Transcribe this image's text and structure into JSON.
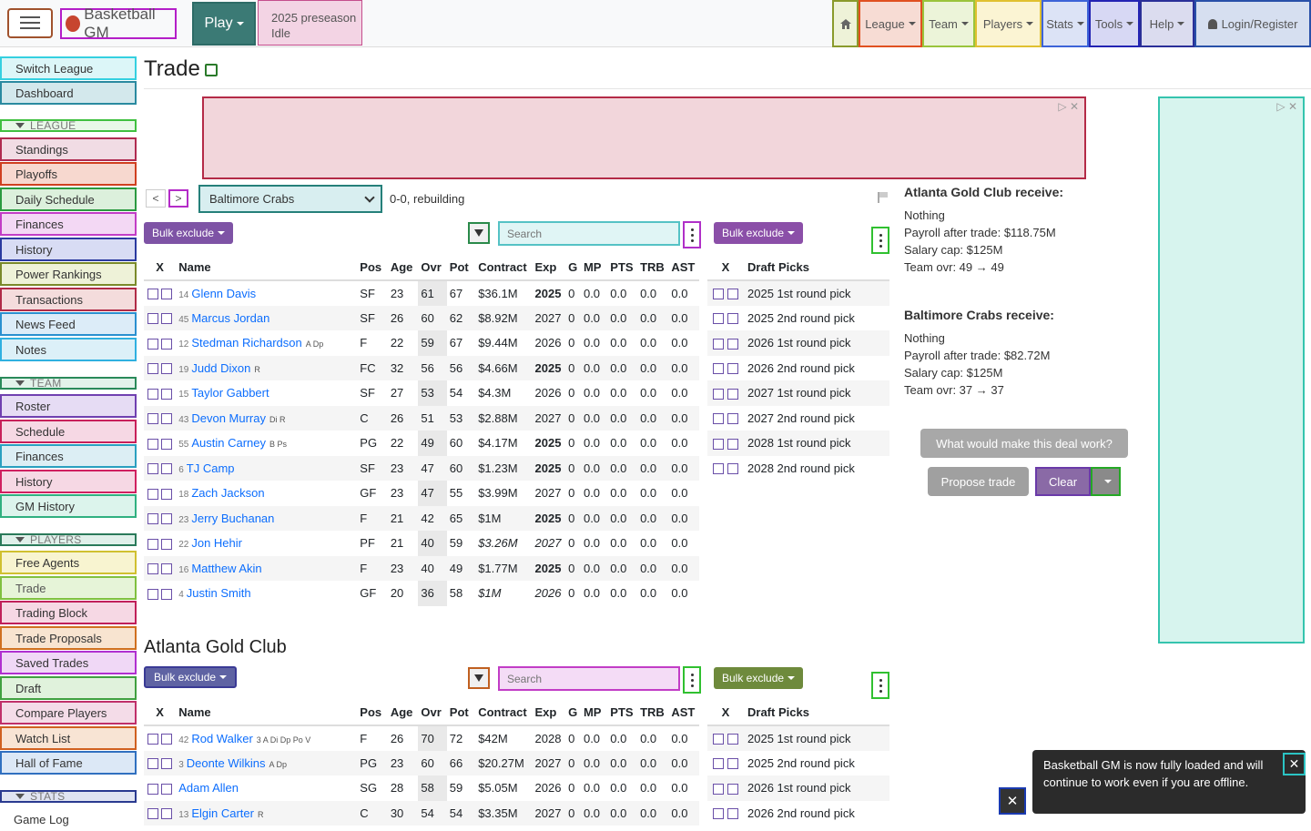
{
  "nav": {
    "brand": "Basketball GM",
    "play": "Play",
    "season": "2025 preseason",
    "status": "Idle",
    "menus": [
      "League",
      "Team",
      "Players",
      "Stats",
      "Tools",
      "Help"
    ],
    "login": "Login/Register"
  },
  "sidebar": {
    "top": [
      "Switch League",
      "Dashboard"
    ],
    "league_head": "LEAGUE",
    "league": [
      "Standings",
      "Playoffs",
      "Daily Schedule",
      "Finances",
      "History",
      "Power Rankings",
      "Transactions",
      "News Feed",
      "Notes"
    ],
    "team_head": "TEAM",
    "team": [
      "Roster",
      "Schedule",
      "Finances",
      "History",
      "GM History"
    ],
    "players_head": "PLAYERS",
    "players": [
      "Free Agents",
      "Trade",
      "Trading Block",
      "Trade Proposals",
      "Saved Trades",
      "Draft",
      "Compare Players",
      "Watch List",
      "Hall of Fame"
    ],
    "stats_head": "STATS",
    "stats": [
      "Game Log"
    ]
  },
  "page": {
    "title": "Trade"
  },
  "team_select": {
    "value": "Baltimore Crabs",
    "record": "0-0, rebuilding"
  },
  "controls": {
    "bulk_exclude": "Bulk exclude",
    "search_placeholder": "Search"
  },
  "columns": [
    "X",
    "Name",
    "Pos",
    "Age",
    "Ovr",
    "Pot",
    "Contract",
    "Exp",
    "G",
    "MP",
    "PTS",
    "TRB",
    "AST"
  ],
  "user_roster": [
    {
      "jersey": "14",
      "name": "Glenn Davis",
      "skills": "",
      "pos": "SF",
      "age": "23",
      "ovr": "61",
      "pot": "67",
      "contract": "$36.1M",
      "exp": "2025",
      "g": "0",
      "mp": "0.0",
      "pts": "0.0",
      "trb": "0.0",
      "ast": "0.0"
    },
    {
      "jersey": "45",
      "name": "Marcus Jordan",
      "skills": "",
      "pos": "SF",
      "age": "26",
      "ovr": "60",
      "pot": "62",
      "contract": "$8.92M",
      "exp": "2027",
      "g": "0",
      "mp": "0.0",
      "pts": "0.0",
      "trb": "0.0",
      "ast": "0.0"
    },
    {
      "jersey": "12",
      "name": "Stedman Richardson",
      "skills": "A Dp",
      "pos": "F",
      "age": "22",
      "ovr": "59",
      "pot": "67",
      "contract": "$9.44M",
      "exp": "2026",
      "g": "0",
      "mp": "0.0",
      "pts": "0.0",
      "trb": "0.0",
      "ast": "0.0"
    },
    {
      "jersey": "19",
      "name": "Judd Dixon",
      "skills": "R",
      "pos": "FC",
      "age": "32",
      "ovr": "56",
      "pot": "56",
      "contract": "$4.66M",
      "exp": "2025",
      "g": "0",
      "mp": "0.0",
      "pts": "0.0",
      "trb": "0.0",
      "ast": "0.0"
    },
    {
      "jersey": "15",
      "name": "Taylor Gabbert",
      "skills": "",
      "pos": "SF",
      "age": "27",
      "ovr": "53",
      "pot": "54",
      "contract": "$4.3M",
      "exp": "2026",
      "g": "0",
      "mp": "0.0",
      "pts": "0.0",
      "trb": "0.0",
      "ast": "0.0"
    },
    {
      "jersey": "43",
      "name": "Devon Murray",
      "skills": "Di R",
      "pos": "C",
      "age": "26",
      "ovr": "51",
      "pot": "53",
      "contract": "$2.88M",
      "exp": "2027",
      "g": "0",
      "mp": "0.0",
      "pts": "0.0",
      "trb": "0.0",
      "ast": "0.0"
    },
    {
      "jersey": "55",
      "name": "Austin Carney",
      "skills": "B Ps",
      "pos": "PG",
      "age": "22",
      "ovr": "49",
      "pot": "60",
      "contract": "$4.17M",
      "exp": "2025",
      "g": "0",
      "mp": "0.0",
      "pts": "0.0",
      "trb": "0.0",
      "ast": "0.0"
    },
    {
      "jersey": "6",
      "name": "TJ Camp",
      "skills": "",
      "pos": "SF",
      "age": "23",
      "ovr": "47",
      "pot": "60",
      "contract": "$1.23M",
      "exp": "2025",
      "g": "0",
      "mp": "0.0",
      "pts": "0.0",
      "trb": "0.0",
      "ast": "0.0"
    },
    {
      "jersey": "18",
      "name": "Zach Jackson",
      "skills": "",
      "pos": "GF",
      "age": "23",
      "ovr": "47",
      "pot": "55",
      "contract": "$3.99M",
      "exp": "2027",
      "g": "0",
      "mp": "0.0",
      "pts": "0.0",
      "trb": "0.0",
      "ast": "0.0"
    },
    {
      "jersey": "23",
      "name": "Jerry Buchanan",
      "skills": "",
      "pos": "F",
      "age": "21",
      "ovr": "42",
      "pot": "65",
      "contract": "$1M",
      "exp": "2025",
      "g": "0",
      "mp": "0.0",
      "pts": "0.0",
      "trb": "0.0",
      "ast": "0.0"
    },
    {
      "jersey": "22",
      "name": "Jon Hehir",
      "skills": "",
      "pos": "PF",
      "age": "21",
      "ovr": "40",
      "pot": "59",
      "contract": "$3.26M",
      "exp": "2027",
      "g": "0",
      "mp": "0.0",
      "pts": "0.0",
      "trb": "0.0",
      "ast": "0.0",
      "italic": true
    },
    {
      "jersey": "16",
      "name": "Matthew Akin",
      "skills": "",
      "pos": "F",
      "age": "23",
      "ovr": "40",
      "pot": "49",
      "contract": "$1.77M",
      "exp": "2025",
      "g": "0",
      "mp": "0.0",
      "pts": "0.0",
      "trb": "0.0",
      "ast": "0.0"
    },
    {
      "jersey": "4",
      "name": "Justin Smith",
      "skills": "",
      "pos": "GF",
      "age": "20",
      "ovr": "36",
      "pot": "58",
      "contract": "$1M",
      "exp": "2026",
      "g": "0",
      "mp": "0.0",
      "pts": "0.0",
      "trb": "0.0",
      "ast": "0.0",
      "italic": true
    }
  ],
  "draft_picks_head": "Draft Picks",
  "user_picks": [
    "2025 1st round pick",
    "2025 2nd round pick",
    "2026 1st round pick",
    "2026 2nd round pick",
    "2027 1st round pick",
    "2027 2nd round pick",
    "2028 1st round pick",
    "2028 2nd round pick"
  ],
  "summary": {
    "other": {
      "title": "Atlanta Gold Club receive:",
      "items": "Nothing",
      "payroll": "Payroll after trade: $118.75M",
      "cap": "Salary cap: $125M",
      "ovr": "Team ovr: 49 → 49"
    },
    "user": {
      "title": "Baltimore Crabs receive:",
      "items": "Nothing",
      "payroll": "Payroll after trade: $82.72M",
      "cap": "Salary cap: $125M",
      "ovr": "Team ovr: 37 → 37"
    }
  },
  "actions": {
    "what_works": "What would make this deal work?",
    "propose": "Propose trade",
    "clear": "Clear"
  },
  "other_team": {
    "name": "Atlanta Gold Club"
  },
  "other_roster": [
    {
      "jersey": "42",
      "name": "Rod Walker",
      "skills": "3 A Di Dp Po V",
      "pos": "F",
      "age": "26",
      "ovr": "70",
      "pot": "72",
      "contract": "$42M",
      "exp": "2028",
      "g": "0",
      "mp": "0.0",
      "pts": "0.0",
      "trb": "0.0",
      "ast": "0.0"
    },
    {
      "jersey": "3",
      "name": "Deonte Wilkins",
      "skills": "A Dp",
      "pos": "PG",
      "age": "23",
      "ovr": "60",
      "pot": "66",
      "contract": "$20.27M",
      "exp": "2027",
      "g": "0",
      "mp": "0.0",
      "pts": "0.0",
      "trb": "0.0",
      "ast": "0.0"
    },
    {
      "jersey": "",
      "name": "Adam Allen",
      "skills": "",
      "pos": "SG",
      "age": "28",
      "ovr": "58",
      "pot": "59",
      "contract": "$5.05M",
      "exp": "2026",
      "g": "0",
      "mp": "0.0",
      "pts": "0.0",
      "trb": "0.0",
      "ast": "0.0"
    },
    {
      "jersey": "13",
      "name": "Elgin Carter",
      "skills": "R",
      "pos": "C",
      "age": "30",
      "ovr": "54",
      "pot": "54",
      "contract": "$3.35M",
      "exp": "2027",
      "g": "0",
      "mp": "0.0",
      "pts": "0.0",
      "trb": "0.0",
      "ast": "0.0"
    }
  ],
  "other_picks": [
    "2025 1st round pick",
    "2025 2nd round pick",
    "2026 1st round pick",
    "2026 2nd round pick"
  ],
  "toast": {
    "message": "Basketball GM is now fully loaded and will continue to work even if you are offline."
  }
}
